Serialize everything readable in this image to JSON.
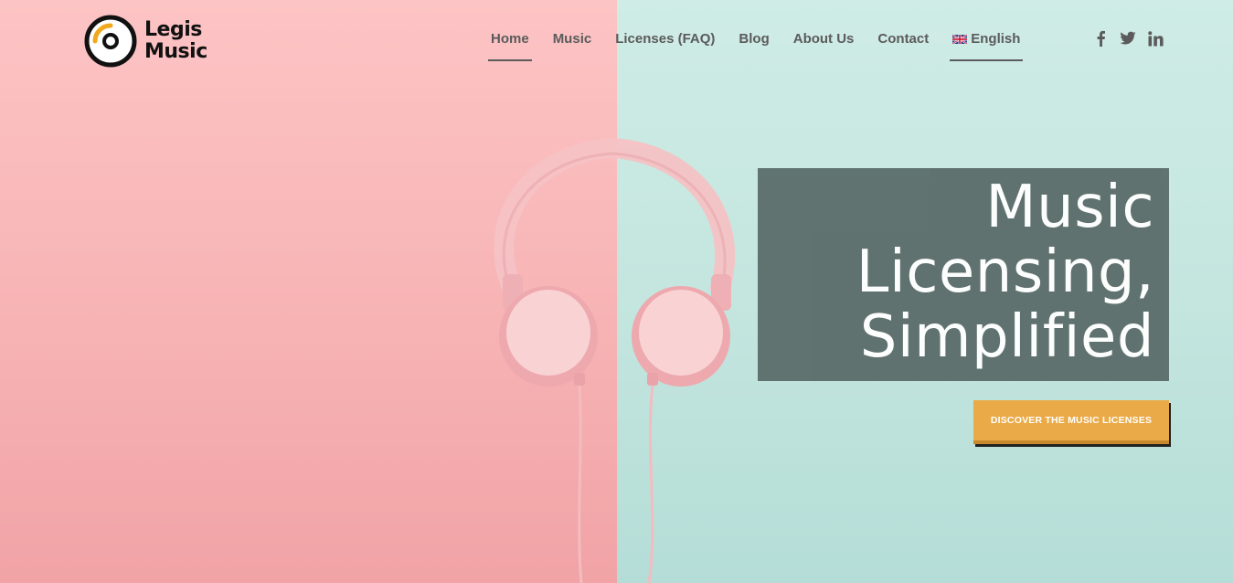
{
  "brand": {
    "name_line1": "Legis",
    "name_line2": "Music"
  },
  "nav": {
    "items": [
      {
        "label": "Home",
        "active": true
      },
      {
        "label": "Music"
      },
      {
        "label": "Licenses (FAQ)"
      },
      {
        "label": "Blog"
      },
      {
        "label": "About Us"
      },
      {
        "label": "Contact"
      }
    ],
    "language": {
      "label": "English",
      "flag_icon": "uk-flag-icon",
      "active": true
    }
  },
  "social": [
    "facebook-icon",
    "twitter-icon",
    "linkedin-icon"
  ],
  "hero": {
    "headline_line1": "Music",
    "headline_line2": "Licensing,",
    "headline_line3": "Simplified",
    "cta_label": "DISCOVER THE MUSIC LICENSES"
  },
  "colors": {
    "bg_left": "#fdc4c5",
    "bg_right": "#c9e9e2",
    "headline_box": "#5c6e6b",
    "cta": "#eaaa47",
    "nav_text": "#5b5b5b",
    "logo_accent": "#f0a81c"
  }
}
